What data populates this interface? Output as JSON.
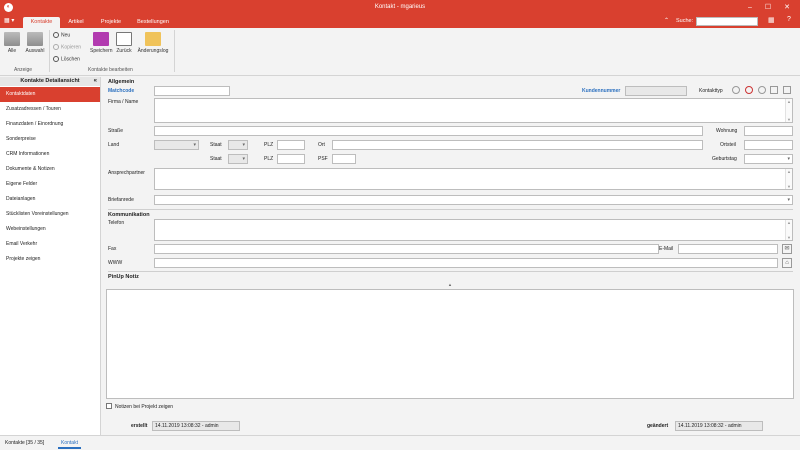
{
  "window": {
    "title": "Kontakt - mgarieus"
  },
  "menu": {
    "tabs": [
      "Kontakte",
      "Artikel",
      "Projekte",
      "Bestellungen"
    ],
    "active_tab": 0,
    "search_label": "Suche:",
    "search_value": ""
  },
  "ribbon": {
    "alle_label": "Alle",
    "auswahl_label": "Auswahl",
    "neu_label": "Neu",
    "kopieren_label": "Kopieren",
    "loeschen_label": "Löschen",
    "speichern_label": "Speichern",
    "zurueck_label": "Zurück",
    "aenderungslog_label": "Änderungslog",
    "group_anzeige": "Anzeige",
    "group_bearbeiten": "Kontakte bearbeiten"
  },
  "sidebar": {
    "header": "Kontakte Detailansicht",
    "items": [
      "Kontaktdaten",
      "Zusatzadressen / Touren",
      "Finanzdaten / Einordnung",
      "Sonderpreise",
      "CRM Informationen",
      "Dokumente & Notizen",
      "Eigene Felder",
      "Dateianlagen",
      "Stücklisten Voreinstellungen",
      "Webeinstellungen",
      "Email Verkehr",
      "Projekte zeigen"
    ],
    "active_index": 0
  },
  "form": {
    "section_allgemein": "Allgemein",
    "matchcode_label": "Matchcode",
    "kundennummer_label": "Kundennummer",
    "kontakttyp_label": "Kontakttyp",
    "firma_label": "Firma / Name",
    "strasse_label": "Straße",
    "wohnung_label": "Wohnung",
    "land_label": "Land",
    "staat_label": "Staat",
    "plz_label": "PLZ",
    "ort_label": "Ort",
    "ortsteil_label": "Ortsteil",
    "psf_label": "PSF",
    "geburtstag_label": "Geburtstag",
    "ansprechpartner_label": "Ansprechpartner",
    "briefanrede_label": "Briefanrede",
    "section_kommunikation": "Kommunikation",
    "telefon_label": "Telefon",
    "fax_label": "Fax",
    "email_label": "E-Mail",
    "www_label": "WWW",
    "pinup_label": "PinUp Notiz",
    "notizen_checkbox_label": "Notizen bei Projekt zeigen",
    "erstellt_label": "erstellt",
    "erstellt_value": "14.11.2019 13:08:32 - admin",
    "geaendert_label": "geändert",
    "geaendert_value": "14.11.2019 13:08:32 - admin"
  },
  "statusbar": {
    "tabs": [
      "Kontakte [35 / 35]",
      "Kontakt"
    ],
    "active_tab": 1
  },
  "colors": {
    "brand_red": "#d9402f",
    "link_blue": "#2a6fbf"
  }
}
